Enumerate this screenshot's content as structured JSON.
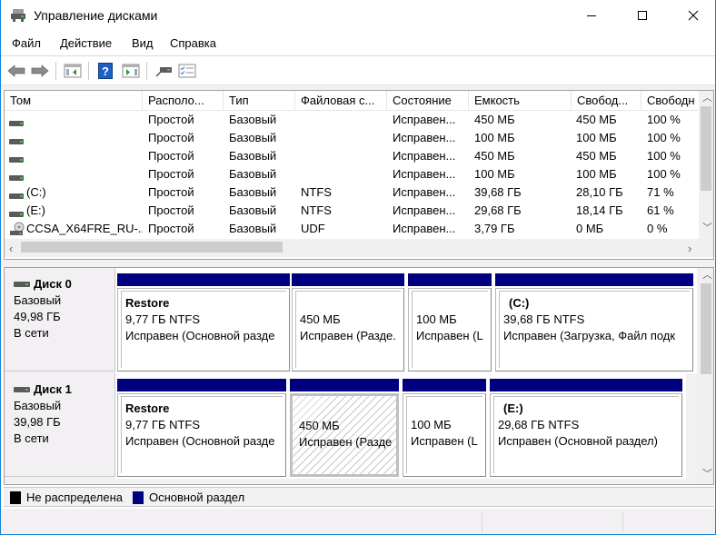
{
  "window": {
    "title": "Управление дисками",
    "controls": {
      "minimize": "—",
      "maximize": "☐",
      "close": "✕"
    }
  },
  "menu": [
    "Файл",
    "Действие",
    "Вид",
    "Справка"
  ],
  "toolbar": {
    "buttons": [
      "back-icon",
      "forward-icon",
      "show-hide-console-tree-icon",
      "help-icon",
      "show-hide-action-pane-icon",
      "connect-disk-icon",
      "properties-checklist-icon"
    ]
  },
  "volume_list": {
    "columns": [
      "Том",
      "Располо...",
      "Тип",
      "Файловая с...",
      "Состояние",
      "Емкость",
      "Свобод...",
      "Свободн"
    ],
    "rows": [
      {
        "icon": "drive-icon",
        "volume": "",
        "layout": "Простой",
        "type": "Базовый",
        "fs": "",
        "status": "Исправен...",
        "capacity": "450 МБ",
        "free": "450 МБ",
        "free_pct": "100 %"
      },
      {
        "icon": "drive-icon",
        "volume": "",
        "layout": "Простой",
        "type": "Базовый",
        "fs": "",
        "status": "Исправен...",
        "capacity": "100 МБ",
        "free": "100 МБ",
        "free_pct": "100 %"
      },
      {
        "icon": "drive-icon",
        "volume": "",
        "layout": "Простой",
        "type": "Базовый",
        "fs": "",
        "status": "Исправен...",
        "capacity": "450 МБ",
        "free": "450 МБ",
        "free_pct": "100 %"
      },
      {
        "icon": "drive-icon",
        "volume": "",
        "layout": "Простой",
        "type": "Базовый",
        "fs": "",
        "status": "Исправен...",
        "capacity": "100 МБ",
        "free": "100 МБ",
        "free_pct": "100 %"
      },
      {
        "icon": "drive-icon",
        "volume": "(C:)",
        "layout": "Простой",
        "type": "Базовый",
        "fs": "NTFS",
        "status": "Исправен...",
        "capacity": "39,68 ГБ",
        "free": "28,10 ГБ",
        "free_pct": "71 %"
      },
      {
        "icon": "drive-icon",
        "volume": "(E:)",
        "layout": "Простой",
        "type": "Базовый",
        "fs": "NTFS",
        "status": "Исправен...",
        "capacity": "29,68 ГБ",
        "free": "18,14 ГБ",
        "free_pct": "61 %"
      },
      {
        "icon": "cd-drive-icon",
        "volume": "CCSA_X64FRE_RU-...",
        "layout": "Простой",
        "type": "Базовый",
        "fs": "UDF",
        "status": "Исправен...",
        "capacity": "3,79 ГБ",
        "free": "0 МБ",
        "free_pct": "0 %"
      }
    ]
  },
  "disks": [
    {
      "name": "Диск 0",
      "type": "Базовый",
      "size": "49,98 ГБ",
      "state": "В сети",
      "partitions": [
        {
          "title": "Restore",
          "line1": "9,77 ГБ NTFS",
          "line2": "Исправен (Основной разде",
          "hatched": false
        },
        {
          "title": "",
          "line1": "450 МБ",
          "line2": "Исправен (Разде.",
          "hatched": false
        },
        {
          "title": "",
          "line1": "100 МБ",
          "line2": "Исправен (L",
          "hatched": false
        },
        {
          "title": "(C:)",
          "line1": "39,68 ГБ NTFS",
          "line2": "Исправен (Загрузка, Файл подк",
          "hatched": false
        }
      ]
    },
    {
      "name": "Диск 1",
      "type": "Базовый",
      "size": "39,98 ГБ",
      "state": "В сети",
      "partitions": [
        {
          "title": "Restore",
          "line1": "9,77 ГБ NTFS",
          "line2": "Исправен (Основной разде",
          "hatched": false
        },
        {
          "title": "",
          "line1": "450 МБ",
          "line2": "Исправен (Разде",
          "hatched": true
        },
        {
          "title": "",
          "line1": "100 МБ",
          "line2": "Исправен (L",
          "hatched": false
        },
        {
          "title": "(E:)",
          "line1": "29,68 ГБ NTFS",
          "line2": "Исправен (Основной раздел)",
          "hatched": false
        }
      ]
    }
  ],
  "legend": [
    {
      "label": "Не распределена",
      "color": "#000000"
    },
    {
      "label": "Основной раздел",
      "color": "#00007f"
    }
  ],
  "colors": {
    "primary_partition": "#00007f",
    "unallocated": "#000000",
    "window_border": "#1883d7"
  }
}
